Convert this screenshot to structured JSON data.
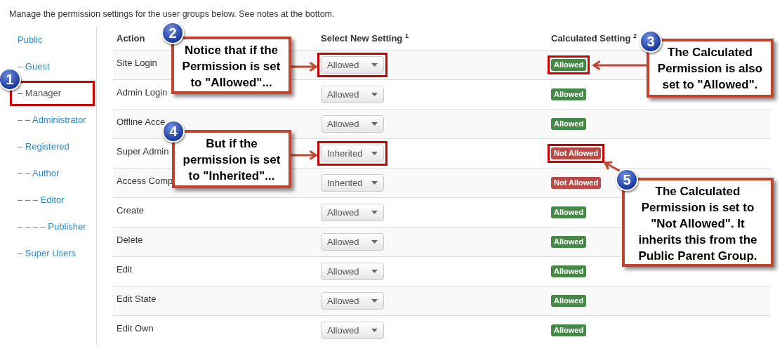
{
  "intro": "Manage the permission settings for the user groups below. See notes at the bottom.",
  "groups": [
    {
      "label": "Public",
      "selected": false,
      "highlighted": false
    },
    {
      "label": "– Guest",
      "selected": false,
      "highlighted": false
    },
    {
      "label": "– Manager",
      "selected": true,
      "highlighted": true
    },
    {
      "label": "– – Administrator",
      "selected": false,
      "highlighted": false
    },
    {
      "label": "– Registered",
      "selected": false,
      "highlighted": false
    },
    {
      "label": "– – Author",
      "selected": false,
      "highlighted": false
    },
    {
      "label": "– – – Editor",
      "selected": false,
      "highlighted": false
    },
    {
      "label": "– – – – Publisher",
      "selected": false,
      "highlighted": false
    },
    {
      "label": "– Super Users",
      "selected": false,
      "highlighted": false
    }
  ],
  "table": {
    "columns": [
      "Action",
      "Select New Setting $^{1}$",
      "Calculated Setting $^{2}$"
    ],
    "rows": [
      {
        "action": "Site Login",
        "setting": "Allowed",
        "setting_highlighted": true,
        "calculated": {
          "text": "Allowed",
          "kind": "allowed",
          "highlighted": true
        }
      },
      {
        "action": "Admin Login",
        "setting": "Allowed",
        "setting_highlighted": false,
        "calculated": {
          "text": "Allowed",
          "kind": "allowed",
          "highlighted": false
        }
      },
      {
        "action": "Offline Acce",
        "setting": "Allowed",
        "setting_highlighted": false,
        "calculated": {
          "text": "Allowed",
          "kind": "allowed",
          "highlighted": false
        }
      },
      {
        "action": "Super Admin",
        "setting": "Inherited",
        "setting_highlighted": true,
        "calculated": {
          "text": "Not Allowed",
          "kind": "denied",
          "highlighted": true
        }
      },
      {
        "action": "Access Comp",
        "setting": "Inherited",
        "setting_highlighted": false,
        "calculated": {
          "text": "Not Allowed",
          "kind": "denied",
          "highlighted": false
        }
      },
      {
        "action": "Create",
        "setting": "Allowed",
        "setting_highlighted": false,
        "calculated": {
          "text": "Allowed",
          "kind": "allowed",
          "highlighted": false
        }
      },
      {
        "action": "Delete",
        "setting": "Allowed",
        "setting_highlighted": false,
        "calculated": {
          "text": "Allowed",
          "kind": "allowed",
          "highlighted": false
        }
      },
      {
        "action": "Edit",
        "setting": "Allowed",
        "setting_highlighted": false,
        "calculated": {
          "text": "Allowed",
          "kind": "allowed",
          "highlighted": false
        }
      },
      {
        "action": "Edit State",
        "setting": "Allowed",
        "setting_highlighted": false,
        "calculated": {
          "text": "Allowed",
          "kind": "allowed",
          "highlighted": false
        }
      },
      {
        "action": "Edit Own",
        "setting": "Allowed",
        "setting_highlighted": false,
        "calculated": {
          "text": "Allowed",
          "kind": "allowed",
          "highlighted": false
        }
      }
    ]
  },
  "callouts": [
    {
      "number": "1"
    },
    {
      "number": "2",
      "text": "Notice that if the\nPermission is set\nto \"Allowed\"..."
    },
    {
      "number": "3",
      "text": "The Calculated\nPermission is also\nset to \"Allowed\"."
    },
    {
      "number": "4",
      "text": "But if the\npermission is set\nto \"Inherited\"..."
    },
    {
      "number": "5",
      "text": "The Calculated\nPermission is set to\n\"Not Allowed\". It\ninherits this from the\nPublic Parent Group."
    }
  ]
}
